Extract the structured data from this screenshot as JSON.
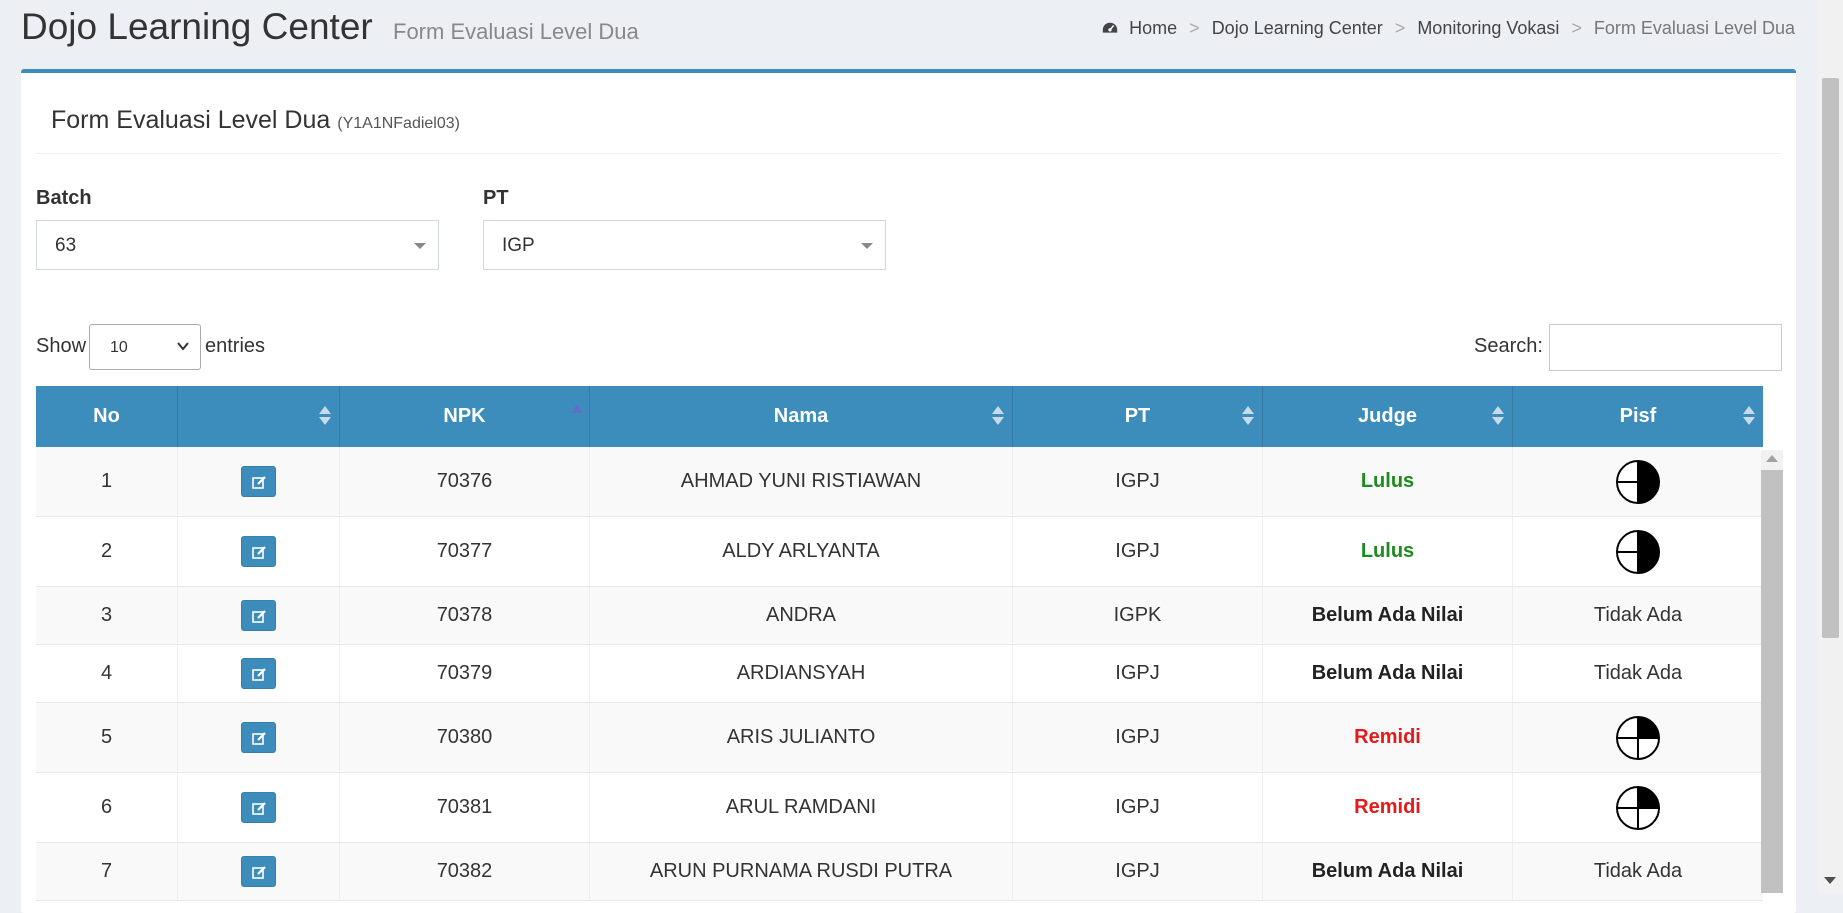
{
  "header": {
    "app_title": "Dojo Learning Center",
    "app_subtitle": "Form Evaluasi Level Dua",
    "breadcrumb": [
      "Home",
      "Dojo Learning Center",
      "Monitoring Vokasi",
      "Form Evaluasi Level Dua"
    ],
    "breadcrumb_separator": ">"
  },
  "form": {
    "title": "Form Evaluasi Level Dua",
    "code": "(Y1A1NFadiel03)",
    "batch_label": "Batch",
    "batch_value": "63",
    "pt_label": "PT",
    "pt_value": "IGP"
  },
  "table_controls": {
    "show_label": "Show",
    "entries_value": "10",
    "entries_label": "entries",
    "search_label": "Search:"
  },
  "table": {
    "columns": [
      "No",
      "",
      "NPK",
      "Nama",
      "PT",
      "Judge",
      "Pisf"
    ],
    "rows": [
      {
        "no": "1",
        "npk": "70376",
        "nama": "AHMAD YUNI RISTIAWAN",
        "pt": "IGPJ",
        "judge": "Lulus",
        "status": "lulus",
        "pisf": "half-filled-circle-icon"
      },
      {
        "no": "2",
        "npk": "70377",
        "nama": "ALDY ARLYANTA",
        "pt": "IGPJ",
        "judge": "Lulus",
        "status": "lulus",
        "pisf": "half-filled-circle-icon"
      },
      {
        "no": "3",
        "npk": "70378",
        "nama": "ANDRA",
        "pt": "IGPK",
        "judge": "Belum Ada Nilai",
        "status": "belum",
        "pisf": "Tidak Ada"
      },
      {
        "no": "4",
        "npk": "70379",
        "nama": "ARDIANSYAH",
        "pt": "IGPJ",
        "judge": "Belum Ada Nilai",
        "status": "belum",
        "pisf": "Tidak Ada"
      },
      {
        "no": "5",
        "npk": "70380",
        "nama": "ARIS JULIANTO",
        "pt": "IGPJ",
        "judge": "Remidi",
        "status": "remidi",
        "pisf": "quarter-filled-circle-icon"
      },
      {
        "no": "6",
        "npk": "70381",
        "nama": "ARUL RAMDANI",
        "pt": "IGPJ",
        "judge": "Remidi",
        "status": "remidi",
        "pisf": "quarter-filled-circle-icon"
      },
      {
        "no": "7",
        "npk": "70382",
        "nama": "ARUN PURNAMA RUSDI PUTRA",
        "pt": "IGPJ",
        "judge": "Belum Ada Nilai",
        "status": "belum",
        "pisf": "Tidak Ada"
      }
    ]
  },
  "colors": {
    "primary": "#3c8dbc",
    "lulus": "#1f8a1f",
    "remidi": "#e41a1a",
    "background": "#ecf0f5"
  }
}
